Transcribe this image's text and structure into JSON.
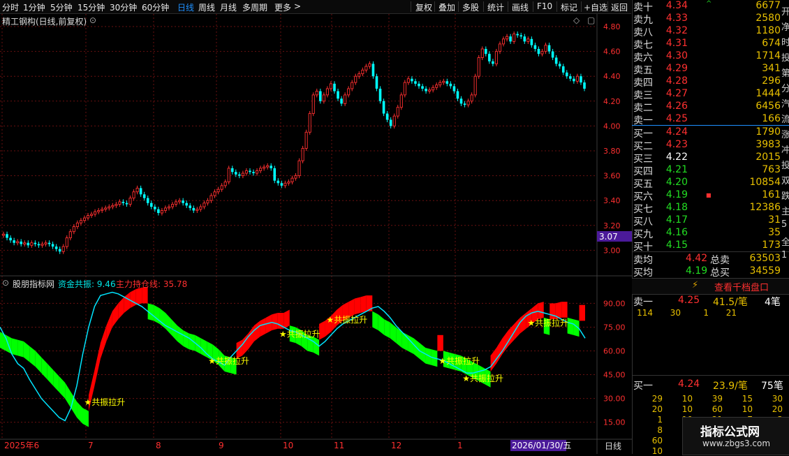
{
  "toolbar": {
    "periods": [
      "分时",
      "1分钟",
      "5分钟",
      "15分钟",
      "30分钟",
      "60分钟",
      "日线",
      "周线",
      "月线",
      "多周期",
      "更多"
    ],
    "more_arrow": ">",
    "actions": [
      "复权",
      "叠加",
      "多股",
      "统计",
      "画线",
      "F10",
      "标记",
      "+自选",
      "返回"
    ]
  },
  "kline": {
    "title": "精工钢构(日线,前复权)",
    "yticks": [
      "4.80",
      "4.60",
      "4.40",
      "4.20",
      "4.00",
      "3.80",
      "3.60",
      "3.40",
      "3.20",
      "3.00"
    ],
    "price_tag": "3.07",
    "closes": [
      3.13,
      3.1,
      3.08,
      3.06,
      3.07,
      3.05,
      3.06,
      3.04,
      3.06,
      3.05,
      3.04,
      3.05,
      3.06,
      3.05,
      3.03,
      3.01,
      2.99,
      3.03,
      3.1,
      3.15,
      3.19,
      3.22,
      3.24,
      3.26,
      3.28,
      3.29,
      3.31,
      3.32,
      3.33,
      3.34,
      3.35,
      3.36,
      3.37,
      3.39,
      3.38,
      3.37,
      3.42,
      3.47,
      3.5,
      3.45,
      3.42,
      3.38,
      3.35,
      3.33,
      3.3,
      3.32,
      3.34,
      3.35,
      3.37,
      3.39,
      3.4,
      3.38,
      3.36,
      3.34,
      3.32,
      3.33,
      3.35,
      3.38,
      3.4,
      3.44,
      3.47,
      3.49,
      3.52,
      3.55,
      3.66,
      3.63,
      3.61,
      3.6,
      3.62,
      3.64,
      3.63,
      3.62,
      3.64,
      3.66,
      3.67,
      3.68,
      3.66,
      3.56,
      3.54,
      3.52,
      3.54,
      3.55,
      3.58,
      3.6,
      3.72,
      3.82,
      3.95,
      4.1,
      4.25,
      4.28,
      4.2,
      4.25,
      4.3,
      4.34,
      4.28,
      4.22,
      4.18,
      4.25,
      4.3,
      4.35,
      4.4,
      4.42,
      4.45,
      4.48,
      4.5,
      4.4,
      4.3,
      4.2,
      4.1,
      4.05,
      4.0,
      4.08,
      4.15,
      4.25,
      4.35,
      4.38,
      4.36,
      4.34,
      4.32,
      4.3,
      4.28,
      4.29,
      4.31,
      4.33,
      4.35,
      4.36,
      4.34,
      4.32,
      4.28,
      4.22,
      4.18,
      4.17,
      4.2,
      4.25,
      4.4,
      4.55,
      4.62,
      4.58,
      4.52,
      4.5,
      4.6,
      4.66,
      4.7,
      4.72,
      4.68,
      4.74,
      4.73,
      4.72,
      4.68,
      4.7,
      4.65,
      4.62,
      4.58,
      4.6,
      4.65,
      4.6,
      4.55,
      4.5,
      4.48,
      4.43,
      4.4,
      4.38,
      4.36,
      4.4,
      4.35,
      4.3
    ]
  },
  "indicator": {
    "site": "股朋指标网",
    "fund_label": "资金共振: 9.46",
    "main_label": "主力持仓线: 35.78",
    "yticks": [
      "90.00",
      "75.00",
      "60.00",
      "45.00",
      "30.00",
      "15.00"
    ],
    "signal_text": "★共振拉升",
    "mainline": [
      72,
      70,
      68,
      67,
      66,
      63,
      60,
      56,
      52,
      48,
      44,
      40,
      34,
      28,
      24,
      22,
      38,
      55,
      66,
      75,
      80,
      84,
      87,
      89,
      90,
      90,
      89,
      87,
      84,
      80,
      76,
      73,
      71,
      70,
      68,
      66,
      64,
      61,
      57,
      56,
      55,
      57,
      61,
      66,
      69,
      71,
      73,
      74,
      74,
      76,
      75,
      73,
      70,
      69,
      67,
      69,
      72,
      76,
      79,
      81,
      83,
      84,
      85,
      85,
      83,
      80,
      78,
      75,
      72,
      70,
      68,
      65,
      62,
      61,
      60,
      60,
      59,
      58,
      57,
      55,
      53,
      51,
      49,
      47,
      52,
      58,
      63,
      67,
      71,
      74,
      77,
      80,
      81,
      80,
      80,
      81,
      81,
      80,
      79,
      79
    ],
    "fundline": [
      75,
      68,
      58,
      52,
      49,
      42,
      36,
      30,
      26,
      22,
      18,
      16,
      24,
      38,
      58,
      75,
      88,
      95,
      96,
      97,
      96,
      94,
      92,
      90,
      88,
      85,
      82,
      79,
      76,
      74,
      72,
      70,
      68,
      65,
      62,
      58,
      55,
      53,
      51,
      56,
      60,
      64,
      69,
      73,
      76,
      77,
      78,
      77,
      75,
      73,
      72,
      70,
      68,
      66,
      63,
      66,
      70,
      74,
      77,
      79,
      81,
      83,
      85,
      87,
      88,
      85,
      81,
      76,
      72,
      68,
      64,
      60,
      58,
      56,
      55,
      54,
      52,
      50,
      48,
      46,
      46,
      47,
      48,
      50,
      55,
      60,
      66,
      72,
      78,
      82,
      84,
      85,
      84,
      83,
      82,
      80,
      78,
      77,
      74,
      68
    ]
  },
  "axis": {
    "months": [
      "2025年6",
      "7",
      "8",
      "9",
      "10",
      "11",
      "12",
      "1"
    ],
    "date_box": "2026/01/30/五",
    "period_label": "日线"
  },
  "orderbook": {
    "asks": [
      {
        "label": "卖十",
        "price": "4.34",
        "vol": "6677",
        "mark": "^"
      },
      {
        "label": "卖九",
        "price": "4.33",
        "vol": "2580"
      },
      {
        "label": "卖八",
        "price": "4.32",
        "vol": "1180"
      },
      {
        "label": "卖七",
        "price": "4.31",
        "vol": "674"
      },
      {
        "label": "卖六",
        "price": "4.30",
        "vol": "1714"
      },
      {
        "label": "卖五",
        "price": "4.29",
        "vol": "341"
      },
      {
        "label": "卖四",
        "price": "4.28",
        "vol": "296"
      },
      {
        "label": "卖三",
        "price": "4.27",
        "vol": "1444"
      },
      {
        "label": "卖二",
        "price": "4.26",
        "vol": "6456"
      },
      {
        "label": "卖一",
        "price": "4.25",
        "vol": "166"
      }
    ],
    "bids": [
      {
        "label": "买一",
        "price": "4.24",
        "vol": "1790",
        "color": "red"
      },
      {
        "label": "买二",
        "price": "4.23",
        "vol": "3983",
        "color": "red"
      },
      {
        "label": "买三",
        "price": "4.22",
        "vol": "2015",
        "color": "wht"
      },
      {
        "label": "买四",
        "price": "4.21",
        "vol": "763",
        "color": "grn"
      },
      {
        "label": "买五",
        "price": "4.20",
        "vol": "10854",
        "color": "grn"
      },
      {
        "label": "买六",
        "price": "4.19",
        "vol": "161",
        "color": "grn",
        "mark": "■"
      },
      {
        "label": "买七",
        "price": "4.18",
        "vol": "12386",
        "color": "grn"
      },
      {
        "label": "买八",
        "price": "4.17",
        "vol": "31",
        "color": "grn"
      },
      {
        "label": "买九",
        "price": "4.16",
        "vol": "35",
        "color": "grn"
      },
      {
        "label": "买十",
        "price": "4.15",
        "vol": "173",
        "color": "grn"
      }
    ],
    "ask_avg": {
      "label": "卖均",
      "price": "4.42",
      "sub": "总卖",
      "vol": "63503"
    },
    "bid_avg": {
      "label": "买均",
      "price": "4.19",
      "sub": "总买",
      "vol": "34559"
    },
    "thousand_btn": "查看千档盘口",
    "lightning": "⚡",
    "level1_sell": {
      "label": "卖一",
      "price": "4.25",
      "avg": "41.5/笔",
      "count": "4笔",
      "queue": [
        "114",
        "30",
        "1",
        "21"
      ]
    },
    "level1_buy": {
      "label": "买一",
      "price": "4.24",
      "avg": "23.9/笔",
      "count": "75笔",
      "queue": [
        [
          "29",
          "10",
          "39",
          "15",
          "30"
        ],
        [
          "20",
          "10",
          "60",
          "10",
          "20"
        ],
        [
          "1",
          "10",
          "21",
          "7",
          "3"
        ],
        [
          "8",
          "",
          "",
          "",
          ""
        ],
        [
          "60",
          "",
          "",
          "",
          ""
        ],
        [
          "10",
          "",
          "",
          "",
          ""
        ]
      ]
    }
  },
  "side_glyphs": [
    "开",
    "净",
    "时",
    "投",
    "第",
    "分",
    "汽",
    "流",
    "涨",
    "冲",
    "投",
    "双",
    "跌",
    "主",
    "5",
    "全",
    "1"
  ],
  "watermark": {
    "title": "指标公式网",
    "url": "www.zbgs3.com"
  },
  "colors": {
    "up": "#ff3030",
    "down": "#00ffff",
    "fill_up": "#ff0000",
    "fill_down": "#00ff00",
    "grid": "#6a1010"
  }
}
